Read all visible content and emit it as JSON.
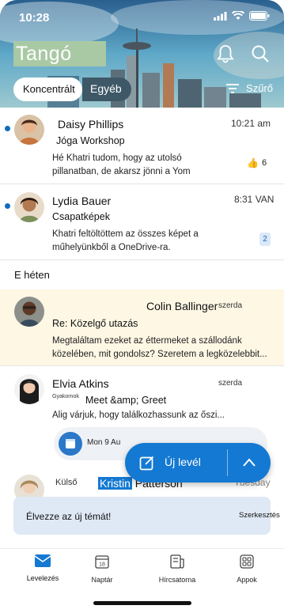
{
  "status": {
    "time": "10:28"
  },
  "header": {
    "title": "Tangó",
    "tabs": [
      {
        "label": "Koncentrált",
        "active": true
      },
      {
        "label": "Egyéb",
        "active": false
      }
    ],
    "filter_label": "Szűrő",
    "icons": [
      "bell-icon",
      "search-icon",
      "filter-icon"
    ]
  },
  "messages": [
    {
      "sender": "Daisy Phillips",
      "time": "10:21 am",
      "subject": "Jóga Workshop",
      "preview": "Hé Khatri tudom, hogy az utolsó pillanatban, de akarsz jönni a Yom",
      "reaction": "👍",
      "reaction_count": "6",
      "unread": true
    },
    {
      "sender": "Lydia Bauer",
      "time": "8:31 VAN",
      "subject": "Csapatképek",
      "preview": "Khatri feltöltöttem az összes képet a műhelyünkből a OneDrive-ra.",
      "badge": "2",
      "unread": true
    }
  ],
  "section_label": "E héten",
  "week_messages": [
    {
      "sender": "Colin Ballinger",
      "time": "szerda",
      "subject": "Re: Közelgő utazás",
      "preview": "Megtaláltam ezeket az éttermeket a szállodánk közelében, mit gondolsz? Szeretem a legközelebbit..."
    },
    {
      "sender": "Elvia Atkins",
      "time": "szerda",
      "tag": "Gyakornok",
      "subject": "Meet &amp; Greet",
      "preview": "Alig várjuk, hogy találkozhassunk az őszi...",
      "calendar_chip": "Mon 9 Au"
    },
    {
      "tag": "Külső",
      "sender_first": "Kristin",
      "sender_last": "Patterson",
      "time": "Tuesday"
    }
  ],
  "fab": {
    "label": "Új levél"
  },
  "toast": {
    "text": "Élvezze az új témát!",
    "action": "Szerkesztés"
  },
  "bottom_nav": [
    {
      "label": "Levelezés",
      "icon": "mail-icon",
      "active": true
    },
    {
      "label": "Naptár",
      "icon": "calendar-icon",
      "active": false
    },
    {
      "label": "Hírcsatorna",
      "icon": "feed-icon",
      "active": false
    },
    {
      "label": "Appok",
      "icon": "apps-icon",
      "active": false
    }
  ],
  "colors": {
    "accent": "#1479d2",
    "unread_dot": "#0f6cbd",
    "highlight_bg": "#fdf7e4",
    "toast_bg": "#dfe9f5"
  }
}
